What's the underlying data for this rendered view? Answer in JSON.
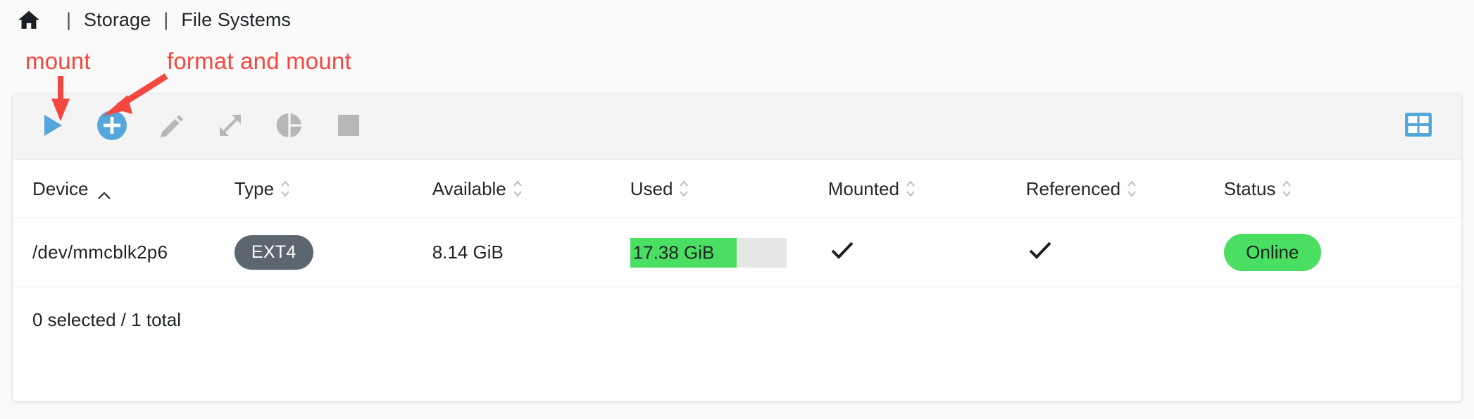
{
  "breadcrumb": {
    "home_icon": "home-icon",
    "separator": "|",
    "items": [
      {
        "label": "Storage"
      },
      {
        "label": "File Systems"
      }
    ]
  },
  "annotations": [
    {
      "id": "mount",
      "text": "mount",
      "color": "#f4473f",
      "points_to": "mount-button"
    },
    {
      "id": "format-and-mount",
      "text": "format and mount",
      "color": "#f4473f",
      "points_to": "create-button"
    }
  ],
  "toolbar": {
    "buttons": [
      {
        "name": "mount-button",
        "icon": "play-icon",
        "label": "Mount",
        "color": "#54a6db",
        "enabled": true
      },
      {
        "name": "create-button",
        "icon": "plus-circle-icon",
        "label": "Create",
        "color": "#54a6db",
        "enabled": true
      },
      {
        "name": "edit-button",
        "icon": "pencil-icon",
        "label": "Edit",
        "color": "#b7b7b7",
        "enabled": false
      },
      {
        "name": "resize-button",
        "icon": "expand-arrows-icon",
        "label": "Resize",
        "color": "#b7b7b7",
        "enabled": false
      },
      {
        "name": "usage-button",
        "icon": "pie-chart-icon",
        "label": "Usage",
        "color": "#b7b7b7",
        "enabled": false
      },
      {
        "name": "unmount-button",
        "icon": "stop-square-icon",
        "label": "Unmount",
        "color": "#b7b7b7",
        "enabled": false
      }
    ],
    "grid_toggle": {
      "name": "column-settings-button",
      "icon": "table-grid-icon",
      "color": "#54a6db"
    }
  },
  "table": {
    "columns": [
      {
        "key": "device",
        "label": "Device",
        "sort": "asc"
      },
      {
        "key": "type",
        "label": "Type",
        "sort": "none"
      },
      {
        "key": "available",
        "label": "Available",
        "sort": "none"
      },
      {
        "key": "used",
        "label": "Used",
        "sort": "none"
      },
      {
        "key": "mounted",
        "label": "Mounted",
        "sort": "none"
      },
      {
        "key": "referenced",
        "label": "Referenced",
        "sort": "none"
      },
      {
        "key": "status",
        "label": "Status",
        "sort": "none"
      }
    ],
    "rows": [
      {
        "device": "/dev/mmcblk2p6",
        "type": "EXT4",
        "available": "8.14 GiB",
        "used": "17.38 GiB",
        "used_percent": 68,
        "mounted": "check",
        "referenced": "check",
        "status": "Online"
      }
    ],
    "footer": "0 selected / 1 total"
  },
  "colors": {
    "accent_blue": "#54a6db",
    "disabled_gray": "#b7b7b7",
    "annotation_red": "#f4473f",
    "status_green": "#4ade62",
    "type_badge_gray": "#5c6670",
    "progress_track": "#e6e6e6",
    "toolbar_bg": "#f4f4f4",
    "page_bg": "#fafafa"
  }
}
